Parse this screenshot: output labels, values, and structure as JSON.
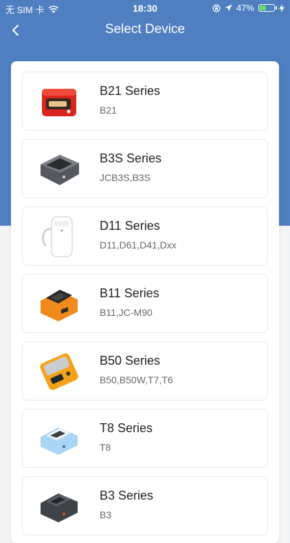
{
  "status_bar": {
    "carrier": "无 SIM 卡",
    "time": "18:30",
    "battery_percent": "47%",
    "battery_level": 0.47,
    "icons": [
      "wifi-icon",
      "rotation-lock-icon",
      "location-icon",
      "charging-icon"
    ]
  },
  "nav": {
    "title": "Select Device",
    "back_icon": "chevron-left-icon"
  },
  "colors": {
    "header": "#4f7fc0",
    "background": "#f4f5f7"
  },
  "devices": [
    {
      "title": "B21 Series",
      "models": "B21",
      "image": "red-label-printer"
    },
    {
      "title": "B3S Series",
      "models": "JCB3S,B3S",
      "image": "gray-label-printer"
    },
    {
      "title": "D11 Series",
      "models": "D11,D61,D41,Dxx",
      "image": "white-label-printer"
    },
    {
      "title": "B11 Series",
      "models": "B11,JC-M90",
      "image": "orange-label-printer"
    },
    {
      "title": "B50 Series",
      "models": "B50,B50W,T7,T6",
      "image": "orange-handheld-printer"
    },
    {
      "title": "T8 Series",
      "models": "T8",
      "image": "blue-label-printer"
    },
    {
      "title": "B3 Series",
      "models": "B3",
      "image": "dark-label-printer"
    }
  ]
}
